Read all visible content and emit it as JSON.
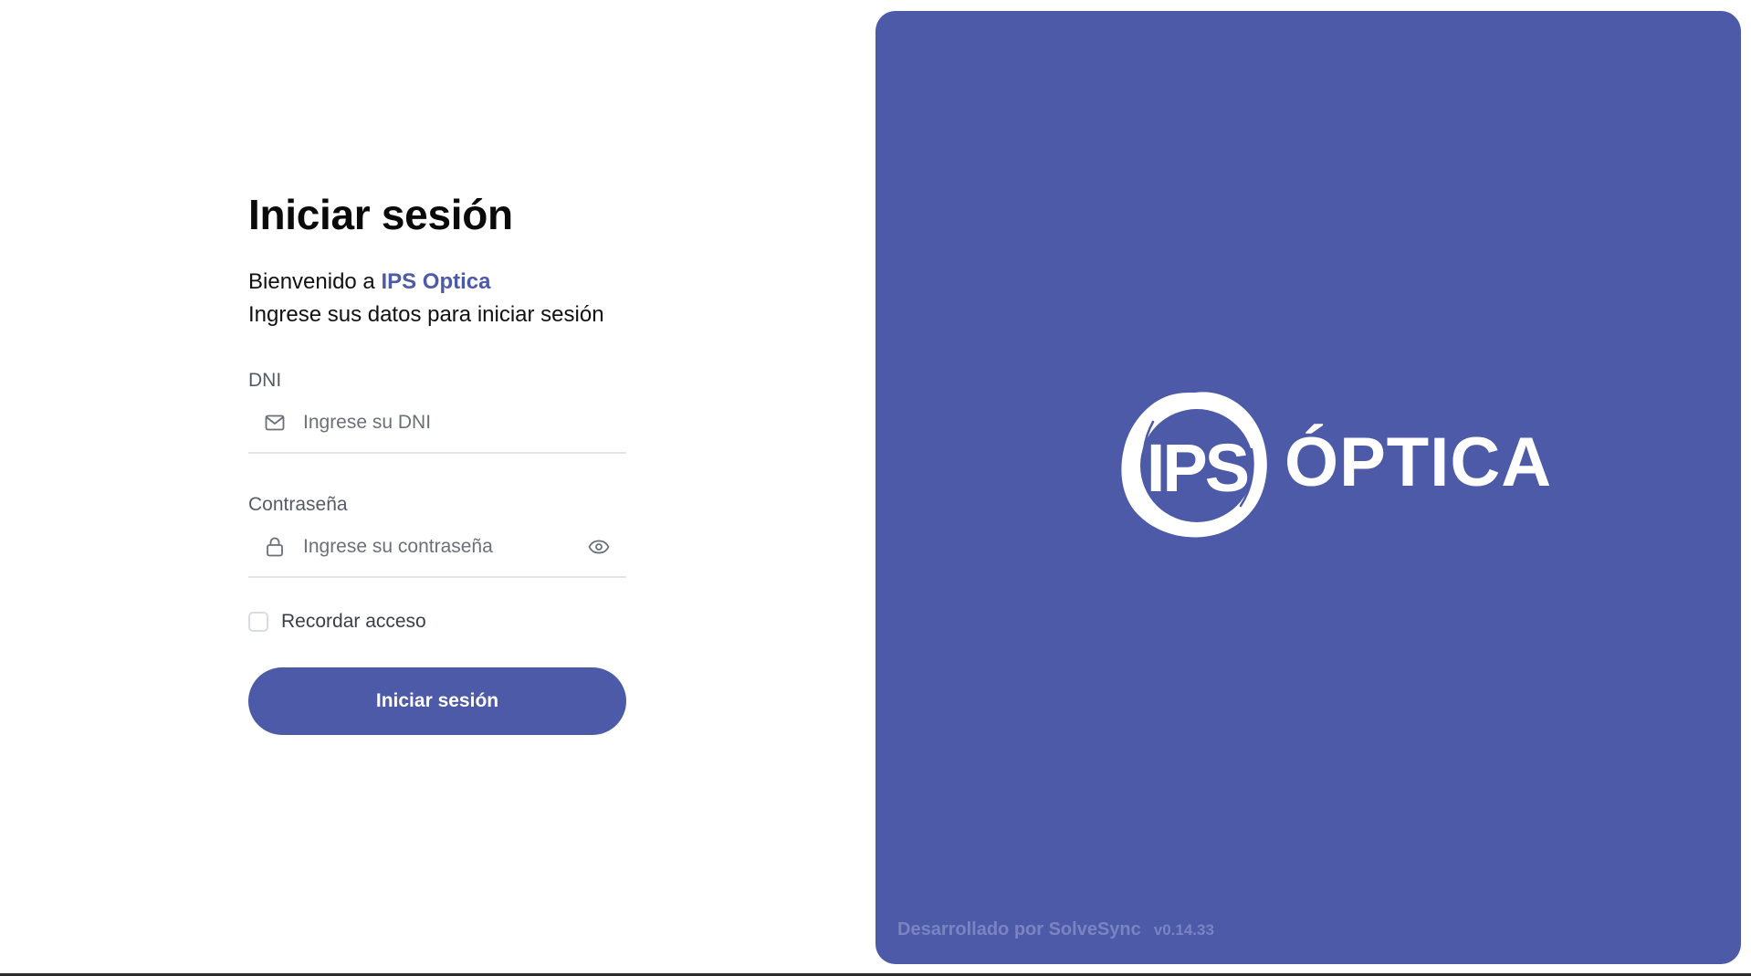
{
  "login": {
    "title": "Iniciar sesión",
    "welcome_prefix": "Bienvenido a ",
    "brand_name": "IPS Optica",
    "subtitle": "Ingrese sus datos para iniciar sesión",
    "dni": {
      "label": "DNI",
      "placeholder": "Ingrese su DNI",
      "value": "",
      "icon": "mail-icon"
    },
    "password": {
      "label": "Contraseña",
      "placeholder": "Ingrese su contraseña",
      "value": "",
      "icon": "lock-icon",
      "toggle_icon": "eye-icon"
    },
    "remember_label": "Recordar acceso",
    "remember_checked": false,
    "submit_label": "Iniciar sesión"
  },
  "panel": {
    "logo_mark_text": "IPS",
    "logo_word": "ÓPTICA",
    "footer_text": "Desarrollado por SolveSync",
    "version": "v0.14.33"
  },
  "colors": {
    "brand": "#4c5aa8",
    "panel_background": "#4c5aa8",
    "button_text": "#ffffff",
    "footer_text": "#7a84c2"
  }
}
